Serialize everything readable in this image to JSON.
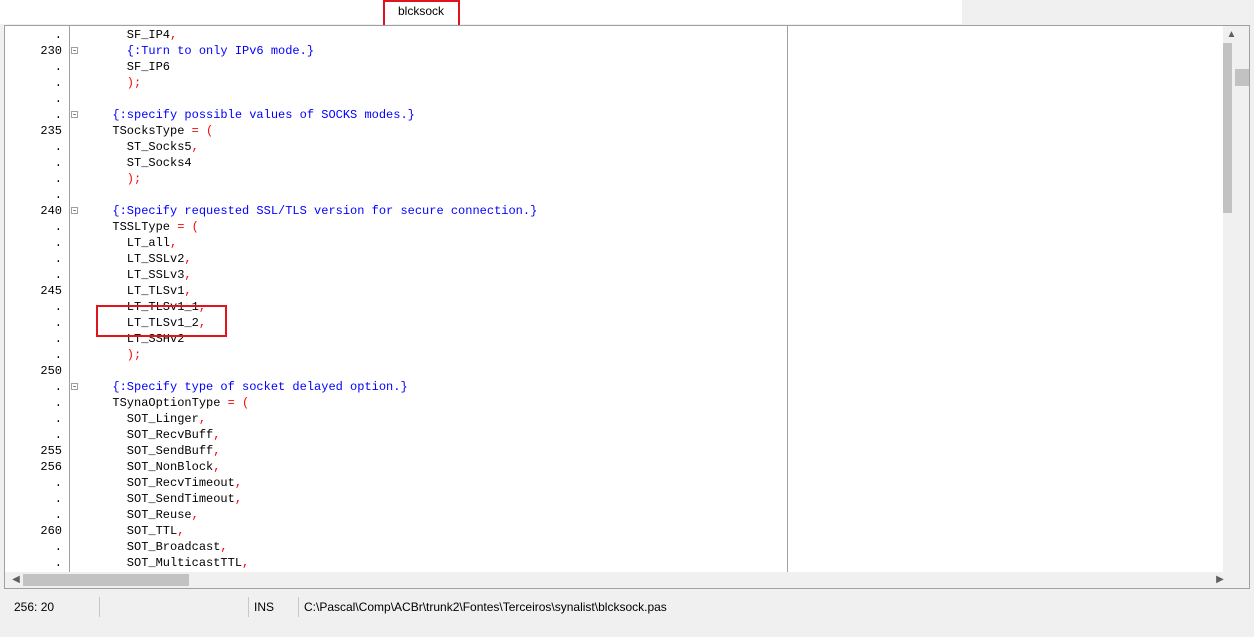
{
  "tab": {
    "title": "blcksock"
  },
  "editor": {
    "lines": [
      {
        "gutter": ".",
        "fold": false,
        "segments": [
          {
            "t": "    SF_IP4",
            "c": "id"
          },
          {
            "t": ",",
            "c": "sym"
          }
        ]
      },
      {
        "gutter": "230",
        "fold": true,
        "segments": [
          {
            "t": "    {:Turn to only IPv6 mode.}",
            "c": "comment"
          }
        ]
      },
      {
        "gutter": ".",
        "fold": false,
        "segments": [
          {
            "t": "    SF_IP6",
            "c": "id"
          }
        ]
      },
      {
        "gutter": ".",
        "fold": false,
        "segments": [
          {
            "t": "    );",
            "c": "sym"
          }
        ]
      },
      {
        "gutter": ".",
        "fold": false,
        "segments": []
      },
      {
        "gutter": ".",
        "fold": true,
        "segments": [
          {
            "t": "  {:specify possible values of SOCKS modes.}",
            "c": "comment"
          }
        ]
      },
      {
        "gutter": "235",
        "fold": false,
        "segments": [
          {
            "t": "  TSocksType ",
            "c": "id"
          },
          {
            "t": "= (",
            "c": "sym"
          }
        ]
      },
      {
        "gutter": ".",
        "fold": false,
        "segments": [
          {
            "t": "    ST_Socks5",
            "c": "id"
          },
          {
            "t": ",",
            "c": "sym"
          }
        ]
      },
      {
        "gutter": ".",
        "fold": false,
        "segments": [
          {
            "t": "    ST_Socks4",
            "c": "id"
          }
        ]
      },
      {
        "gutter": ".",
        "fold": false,
        "segments": [
          {
            "t": "    );",
            "c": "sym"
          }
        ]
      },
      {
        "gutter": ".",
        "fold": false,
        "segments": []
      },
      {
        "gutter": "240",
        "fold": true,
        "segments": [
          {
            "t": "  {:Specify requested SSL/TLS version for secure connection.}",
            "c": "comment"
          }
        ]
      },
      {
        "gutter": ".",
        "fold": false,
        "segments": [
          {
            "t": "  TSSLType ",
            "c": "id"
          },
          {
            "t": "= (",
            "c": "sym"
          }
        ]
      },
      {
        "gutter": ".",
        "fold": false,
        "segments": [
          {
            "t": "    LT_all",
            "c": "id"
          },
          {
            "t": ",",
            "c": "sym"
          }
        ]
      },
      {
        "gutter": ".",
        "fold": false,
        "segments": [
          {
            "t": "    LT_SSLv2",
            "c": "id"
          },
          {
            "t": ",",
            "c": "sym"
          }
        ]
      },
      {
        "gutter": ".",
        "fold": false,
        "segments": [
          {
            "t": "    LT_SSLv3",
            "c": "id"
          },
          {
            "t": ",",
            "c": "sym"
          }
        ]
      },
      {
        "gutter": "245",
        "fold": false,
        "segments": [
          {
            "t": "    LT_TLSv1",
            "c": "id"
          },
          {
            "t": ",",
            "c": "sym"
          }
        ]
      },
      {
        "gutter": ".",
        "fold": false,
        "segments": [
          {
            "t": "    LT_TLSv1_1",
            "c": "id"
          },
          {
            "t": ",",
            "c": "sym"
          }
        ]
      },
      {
        "gutter": ".",
        "fold": false,
        "segments": [
          {
            "t": "    LT_TLSv1_2",
            "c": "id"
          },
          {
            "t": ",",
            "c": "sym"
          }
        ]
      },
      {
        "gutter": ".",
        "fold": false,
        "segments": [
          {
            "t": "    LT_SSHv2",
            "c": "id"
          }
        ]
      },
      {
        "gutter": ".",
        "fold": false,
        "segments": [
          {
            "t": "    );",
            "c": "sym"
          }
        ]
      },
      {
        "gutter": "250",
        "fold": false,
        "segments": []
      },
      {
        "gutter": ".",
        "fold": true,
        "segments": [
          {
            "t": "  {:Specify type of socket delayed option.}",
            "c": "comment"
          }
        ]
      },
      {
        "gutter": ".",
        "fold": false,
        "segments": [
          {
            "t": "  TSynaOptionType ",
            "c": "id"
          },
          {
            "t": "= (",
            "c": "sym"
          }
        ]
      },
      {
        "gutter": ".",
        "fold": false,
        "segments": [
          {
            "t": "    SOT_Linger",
            "c": "id"
          },
          {
            "t": ",",
            "c": "sym"
          }
        ]
      },
      {
        "gutter": ".",
        "fold": false,
        "segments": [
          {
            "t": "    SOT_RecvBuff",
            "c": "id"
          },
          {
            "t": ",",
            "c": "sym"
          }
        ]
      },
      {
        "gutter": "255",
        "fold": false,
        "segments": [
          {
            "t": "    SOT_SendBuff",
            "c": "id"
          },
          {
            "t": ",",
            "c": "sym"
          }
        ]
      },
      {
        "gutter": "256",
        "fold": false,
        "segments": [
          {
            "t": "    SOT_NonBlock",
            "c": "id"
          },
          {
            "t": ",",
            "c": "sym"
          }
        ]
      },
      {
        "gutter": ".",
        "fold": false,
        "segments": [
          {
            "t": "    SOT_RecvTimeout",
            "c": "id"
          },
          {
            "t": ",",
            "c": "sym"
          }
        ]
      },
      {
        "gutter": ".",
        "fold": false,
        "segments": [
          {
            "t": "    SOT_SendTimeout",
            "c": "id"
          },
          {
            "t": ",",
            "c": "sym"
          }
        ]
      },
      {
        "gutter": ".",
        "fold": false,
        "segments": [
          {
            "t": "    SOT_Reuse",
            "c": "id"
          },
          {
            "t": ",",
            "c": "sym"
          }
        ]
      },
      {
        "gutter": "260",
        "fold": false,
        "segments": [
          {
            "t": "    SOT_TTL",
            "c": "id"
          },
          {
            "t": ",",
            "c": "sym"
          }
        ]
      },
      {
        "gutter": ".",
        "fold": false,
        "segments": [
          {
            "t": "    SOT_Broadcast",
            "c": "id"
          },
          {
            "t": ",",
            "c": "sym"
          }
        ]
      },
      {
        "gutter": ".",
        "fold": false,
        "segments": [
          {
            "t": "    SOT_MulticastTTL",
            "c": "id"
          },
          {
            "t": ",",
            "c": "sym"
          }
        ]
      }
    ]
  },
  "statusbar": {
    "position": "256: 20",
    "blank": "",
    "mode": "INS",
    "filepath": "C:\\Pascal\\Comp\\ACBr\\trunk2\\Fontes\\Terceiros\\synalist\\blcksock.pas"
  },
  "colors": {
    "comment": "#0000ff",
    "symbol": "#ff0000",
    "identifier": "#000000",
    "highlight": "#e0141e"
  }
}
